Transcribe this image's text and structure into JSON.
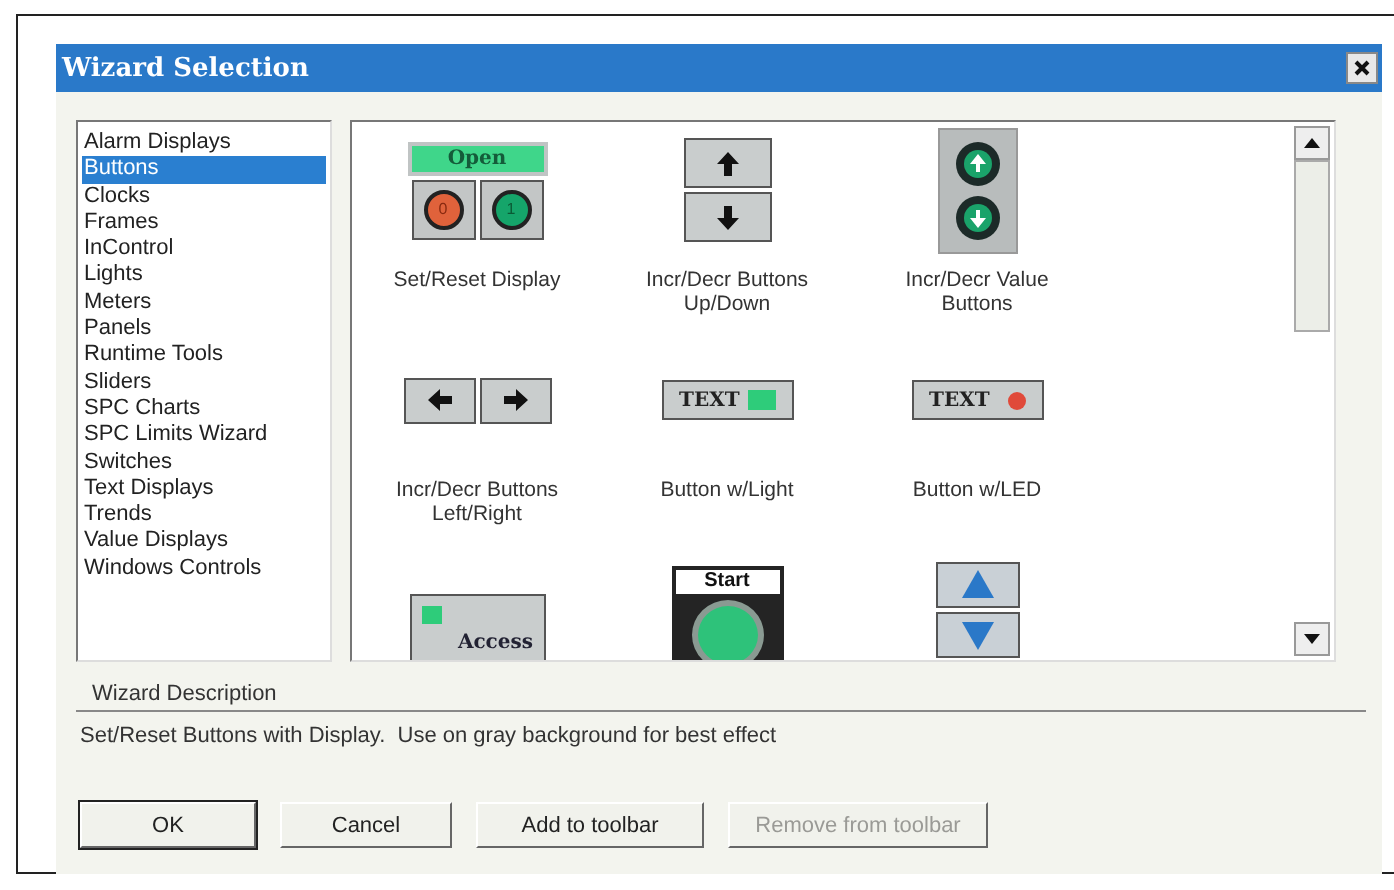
{
  "window": {
    "title": "Wizard Selection"
  },
  "categories": [
    {
      "label": "Alarm Displays",
      "selected": false
    },
    {
      "label": "Buttons",
      "selected": true
    },
    {
      "label": "Clocks",
      "selected": false
    },
    {
      "label": "Frames",
      "selected": false
    },
    {
      "label": "InControl",
      "selected": false
    },
    {
      "label": "Lights",
      "selected": false
    },
    {
      "label": "Meters",
      "selected": false
    },
    {
      "label": "Panels",
      "selected": false
    },
    {
      "label": "Runtime Tools",
      "selected": false
    },
    {
      "label": "Sliders",
      "selected": false
    },
    {
      "label": "SPC Charts",
      "selected": false
    },
    {
      "label": "SPC Limits Wizard",
      "selected": false
    },
    {
      "label": "Switches",
      "selected": false
    },
    {
      "label": "Text Displays",
      "selected": false
    },
    {
      "label": "Trends",
      "selected": false
    },
    {
      "label": "Value Displays",
      "selected": false
    },
    {
      "label": "Windows Controls",
      "selected": false
    }
  ],
  "wizards": [
    {
      "kind": "set-reset",
      "texts": [
        "Open",
        "0",
        "1"
      ],
      "label": "Set/Reset Display"
    },
    {
      "kind": "updown-arrows",
      "label": "Incr/Decr Buttons Up/Down"
    },
    {
      "kind": "updown-value",
      "label": "Incr/Decr Value Buttons"
    },
    {
      "kind": "leftright-arrows",
      "label": "Incr/Decr Buttons Left/Right"
    },
    {
      "kind": "button-light",
      "texts": [
        "TEXT"
      ],
      "label": "Button w/Light"
    },
    {
      "kind": "button-led",
      "texts": [
        "TEXT"
      ],
      "label": "Button w/LED"
    },
    {
      "kind": "access",
      "texts": [
        "Access"
      ]
    },
    {
      "kind": "start",
      "texts": [
        "Start"
      ]
    },
    {
      "kind": "updown-triangles"
    }
  ],
  "description": {
    "label": "Wizard Description",
    "text": "Set/Reset Buttons with Display.  Use on gray background for best effect"
  },
  "buttons": [
    {
      "label": "OK",
      "disabled": false,
      "default": true
    },
    {
      "label": "Cancel",
      "disabled": false,
      "default": false
    },
    {
      "label": "Add to toolbar",
      "disabled": false,
      "default": false
    },
    {
      "label": "Remove from toolbar",
      "disabled": true,
      "default": false
    }
  ]
}
